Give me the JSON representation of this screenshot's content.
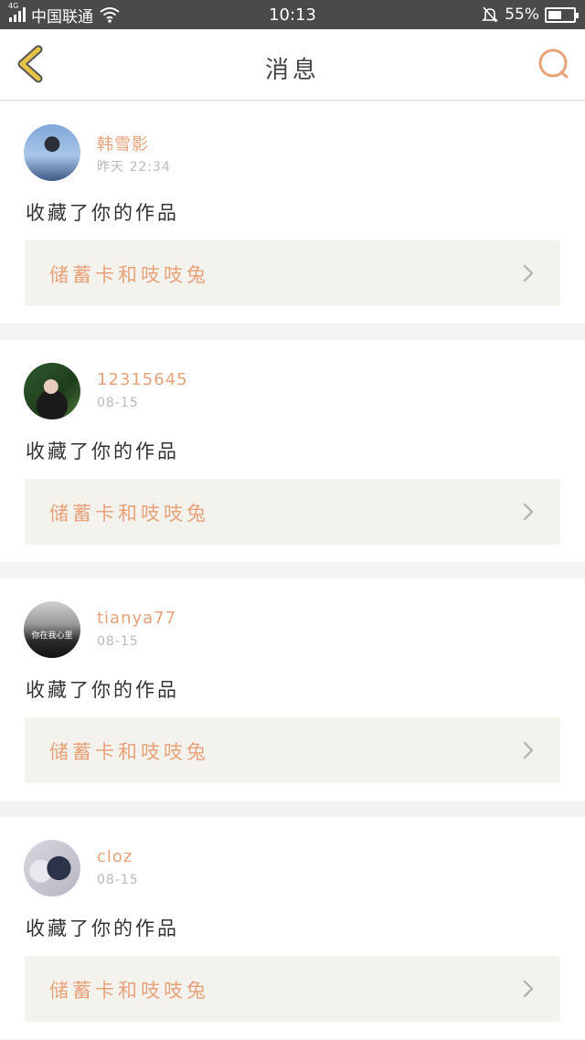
{
  "status_bar": {
    "network_badge": "4G",
    "carrier": "中国联通",
    "time": "10:13",
    "battery": "55%",
    "battery_level": 0.55
  },
  "header": {
    "title": "消息",
    "accent_color": "#e8a27a",
    "back_icon_color": "#e6c44a"
  },
  "messages": [
    {
      "user": "韩雪影",
      "time": "昨天  22:34",
      "action": "收藏了你的作品",
      "work_title": "储蓄卡和吱吱兔",
      "avatar_caption": ""
    },
    {
      "user": "12315645",
      "time": "08-15",
      "action": "收藏了你的作品",
      "work_title": "储蓄卡和吱吱兔",
      "avatar_caption": ""
    },
    {
      "user": "tianya77",
      "time": "08-15",
      "action": "收藏了你的作品",
      "work_title": "储蓄卡和吱吱兔",
      "avatar_caption": "你在我心里"
    },
    {
      "user": "cloz",
      "time": "08-15",
      "action": "收藏了你的作品",
      "work_title": "储蓄卡和吱吱兔",
      "avatar_caption": ""
    }
  ]
}
